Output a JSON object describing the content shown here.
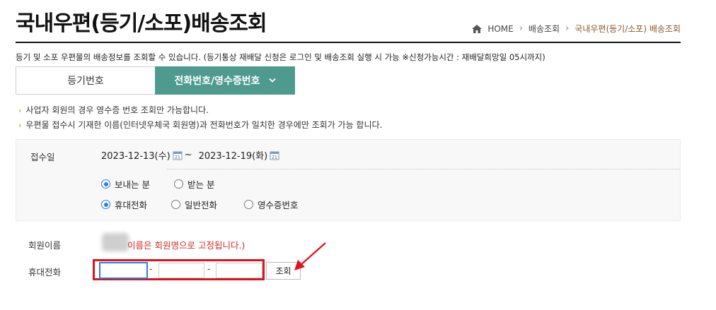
{
  "page": {
    "title": "국내우편(등기/소포)배송조회",
    "breadcrumb": {
      "home": "HOME",
      "level1": "배송조회",
      "current": "국내우편(등기/소포) 배송조회"
    },
    "intro": "등기 및 소포 우편물의 배송정보를 조회할 수 있습니다. (등기통상 재배달 신청은 로그인 및 배송조회 실행 시 가능 ※신청가능시간 : 재배달희망일 05시까지)"
  },
  "tabs": {
    "inactive_label": "등기번호",
    "active_label": "전화번호/영수증번호"
  },
  "notes": [
    "사업자 회원의 경우 영수증 번호 조회만 가능합니다.",
    "우편물 접수시 기재한 이름(인터넷우체국 회원명)과 전화번호가 일치한 경우에만 조회가 가능 합니다."
  ],
  "form": {
    "date_label": "접수일",
    "date_from": "2023-12-13(수)",
    "date_sep": "~",
    "date_to": "2023-12-19(화)",
    "sender_option": "보내는 분",
    "receiver_option": "받는 분",
    "selected_party": "보내는 분",
    "mobile_option": "휴대전화",
    "landline_option": "일반전화",
    "receipt_option": "영수증번호",
    "selected_type": "휴대전화",
    "member_name_label": "회원이름",
    "member_name_note": "이름은 회원명으로 고정됩니다.)",
    "phone_label": "휴대전화",
    "phone_part1": "",
    "phone_part2": "",
    "phone_part3": "",
    "phone_sep": "-",
    "search_button": "조회"
  },
  "colors": {
    "accent_tab": "#4e9a8f",
    "highlight": "#e0121b",
    "warning_text": "#d62828",
    "breadcrumb_current": "#8a5a2b"
  },
  "icons": [
    "home-icon",
    "chevron-down-icon",
    "calendar-icon",
    "arrow-annotation-icon"
  ]
}
